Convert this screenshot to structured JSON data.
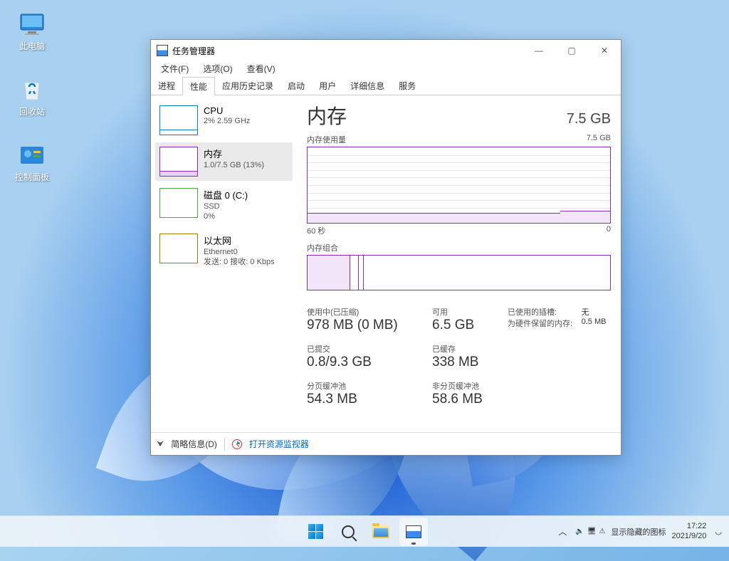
{
  "desktop": {
    "icons": [
      "此电脑",
      "回收站",
      "控制面板"
    ]
  },
  "window": {
    "title": "任务管理器",
    "menu": [
      "文件(F)",
      "选项(O)",
      "查看(V)"
    ],
    "tabs": [
      "进程",
      "性能",
      "应用历史记录",
      "启动",
      "用户",
      "详细信息",
      "服务"
    ],
    "active_tab": 1,
    "sidebar": [
      {
        "name": "CPU",
        "line1": "2% 2.59 GHz",
        "line2": ""
      },
      {
        "name": "内存",
        "line1": "1.0/7.5 GB (13%)",
        "line2": ""
      },
      {
        "name": "磁盘 0 (C:)",
        "line1": "SSD",
        "line2": "0%"
      },
      {
        "name": "以太网",
        "line1": "Ethernet0",
        "line2": "发送: 0 接收: 0 Kbps"
      }
    ],
    "selected_side": 1,
    "main": {
      "title": "内存",
      "capacity": "7.5 GB",
      "usage_label": "内存使用量",
      "usage_max": "7.5 GB",
      "axis_left": "60 秒",
      "axis_right": "0",
      "comp_label": "内存组合",
      "stats": [
        [
          {
            "lbl": "使用中(已压缩)",
            "val": "978 MB (0 MB)"
          },
          {
            "lbl": "可用",
            "val": "6.5 GB"
          },
          {
            "lbl": "已使用的插槽:",
            "val": "无"
          },
          {
            "lbl": "为硬件保留的内存:",
            "val": "0.5 MB"
          }
        ],
        [
          {
            "lbl": "已提交",
            "val": "0.8/9.3 GB"
          },
          {
            "lbl": "已缓存",
            "val": "338 MB"
          }
        ],
        [
          {
            "lbl": "分页缓冲池",
            "val": "54.3 MB"
          },
          {
            "lbl": "非分页缓冲池",
            "val": "58.6 MB"
          }
        ]
      ]
    },
    "footer": {
      "collapse": "简略信息(D)",
      "link": "打开资源监视器"
    }
  },
  "taskbar": {
    "hidden_icons": "显示隐藏的图标",
    "time": "17:22",
    "date": "2021/9/20"
  },
  "chart_data": {
    "type": "line",
    "title": "内存使用量",
    "xlabel": "60 秒",
    "ylabel": "GB",
    "ylim": [
      0,
      7.5
    ],
    "x": [
      60,
      55,
      50,
      45,
      40,
      35,
      30,
      25,
      20,
      15,
      10,
      5,
      0
    ],
    "values": [
      1.0,
      1.0,
      1.0,
      1.0,
      1.0,
      1.0,
      1.0,
      1.0,
      1.0,
      1.0,
      1.0,
      1.05,
      1.1
    ]
  }
}
